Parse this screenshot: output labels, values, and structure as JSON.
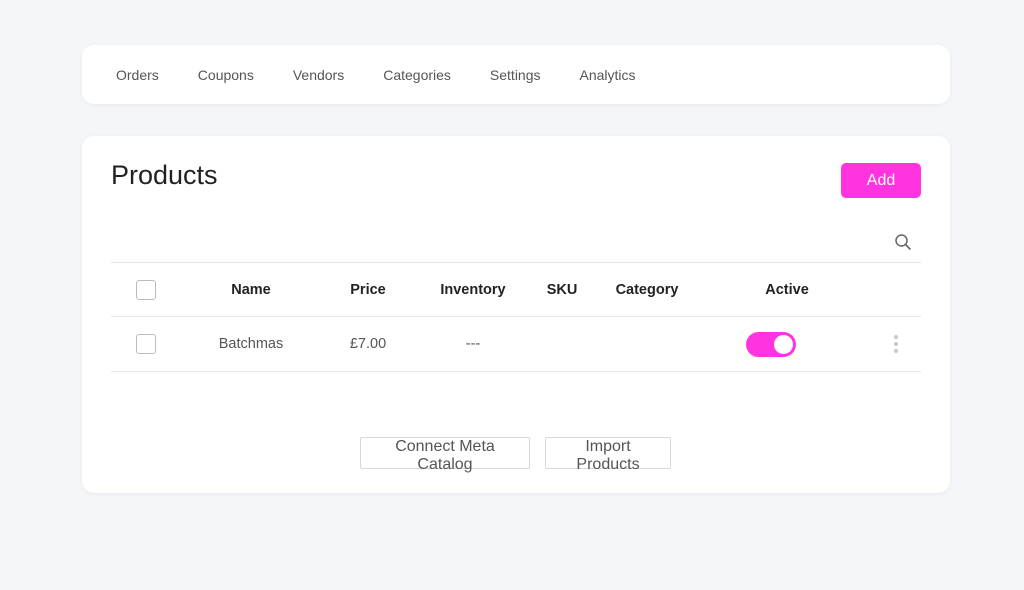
{
  "nav": {
    "items": [
      {
        "label": "Orders"
      },
      {
        "label": "Coupons"
      },
      {
        "label": "Vendors"
      },
      {
        "label": "Categories"
      },
      {
        "label": "Settings"
      },
      {
        "label": "Analytics"
      }
    ]
  },
  "page": {
    "title": "Products",
    "add_label": "Add",
    "search_icon": "search-icon"
  },
  "table": {
    "columns": [
      "Name",
      "Price",
      "Inventory",
      "SKU",
      "Category",
      "Active"
    ],
    "rows": [
      {
        "name": "Batchmas",
        "price": "£7.00",
        "inventory": "---",
        "sku": "",
        "category": "",
        "active": true
      }
    ]
  },
  "footer": {
    "connect_label": "Connect Meta Catalog",
    "import_label": "Import Products"
  },
  "colors": {
    "accent": "#ff33e0",
    "background": "#f5f6f9"
  }
}
